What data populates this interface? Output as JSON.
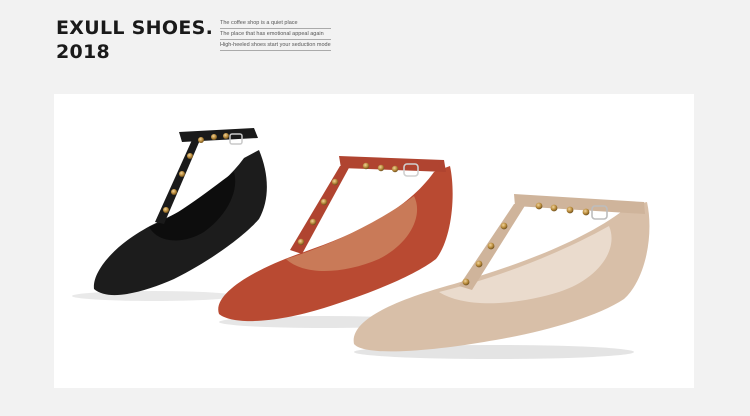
{
  "header": {
    "title_line1": "EXULL SHOES.",
    "title_line2": "2018",
    "tagline": [
      "The coffee shop is a quiet place",
      "The place that has emotional appeal again",
      "High-heeled shoes start your seduction mode"
    ]
  },
  "product_photo": {
    "shoes": [
      {
        "color_name": "black",
        "color": "#1c1c1c"
      },
      {
        "color_name": "rust",
        "color": "#b94a32"
      },
      {
        "color_name": "beige",
        "color": "#d8bfa8"
      }
    ],
    "stud_color": "#b88a3a"
  }
}
